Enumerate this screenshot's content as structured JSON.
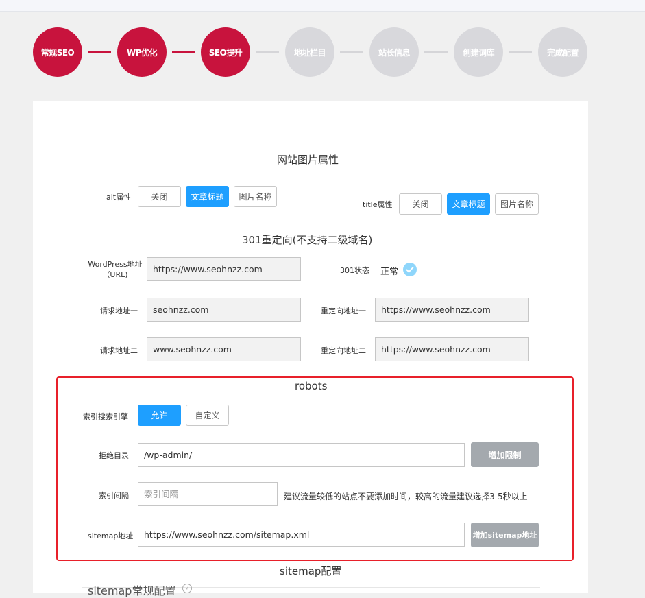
{
  "steps": [
    {
      "label": "常规SEO",
      "state": "active"
    },
    {
      "label": "WP优化",
      "state": "active"
    },
    {
      "label": "SEO提升",
      "state": "active"
    },
    {
      "label": "地址栏目",
      "state": "inactive"
    },
    {
      "label": "站长信息",
      "state": "inactive"
    },
    {
      "label": "创建词库",
      "state": "inactive"
    },
    {
      "label": "完成配置",
      "state": "inactive"
    }
  ],
  "image_attrs": {
    "title": "网站图片属性",
    "alt_label": "alt属性",
    "title_label": "title属性",
    "options": [
      "关闭",
      "文章标题",
      "图片名称"
    ],
    "alt_selected": "文章标题",
    "title_selected": "文章标题"
  },
  "redirect": {
    "title": "301重定向(不支持二级域名)",
    "wp_url_label": "WordPress地址（URL)",
    "wp_url_value": "https://www.seohnzz.com",
    "status_label": "301状态",
    "status_value": "正常",
    "req1_label": "请求地址一",
    "req1_value": "seohnzz.com",
    "redir1_label": "重定向地址一",
    "redir1_value": "https://www.seohnzz.com",
    "req2_label": "请求地址二",
    "req2_value": "www.seohnzz.com",
    "redir2_label": "重定向地址二",
    "redir2_value": "https://www.seohnzz.com"
  },
  "robots": {
    "title": "robots",
    "index_label": "索引搜索引擎",
    "allow_label": "允许",
    "custom_label": "自定义",
    "deny_label": "拒绝目录",
    "deny_value": "/wp-admin/",
    "add_limit_label": "增加限制",
    "interval_label": "索引间隔",
    "interval_placeholder": "索引间隔",
    "interval_hint": "建议流量较低的站点不要添加时间，较高的流量建议选择3-5秒以上",
    "sitemap_label": "sitemap地址",
    "sitemap_value": "https://www.seohnzz.com/sitemap.xml",
    "add_sitemap_label": "增加sitemap地址"
  },
  "sitemap": {
    "title": "sitemap配置",
    "sub_title": "sitemap常规配置"
  },
  "colors": {
    "active": "#c8133d",
    "inactive": "#d8d8dc",
    "primary": "#1e9fff",
    "highlight": "#e8202a"
  }
}
